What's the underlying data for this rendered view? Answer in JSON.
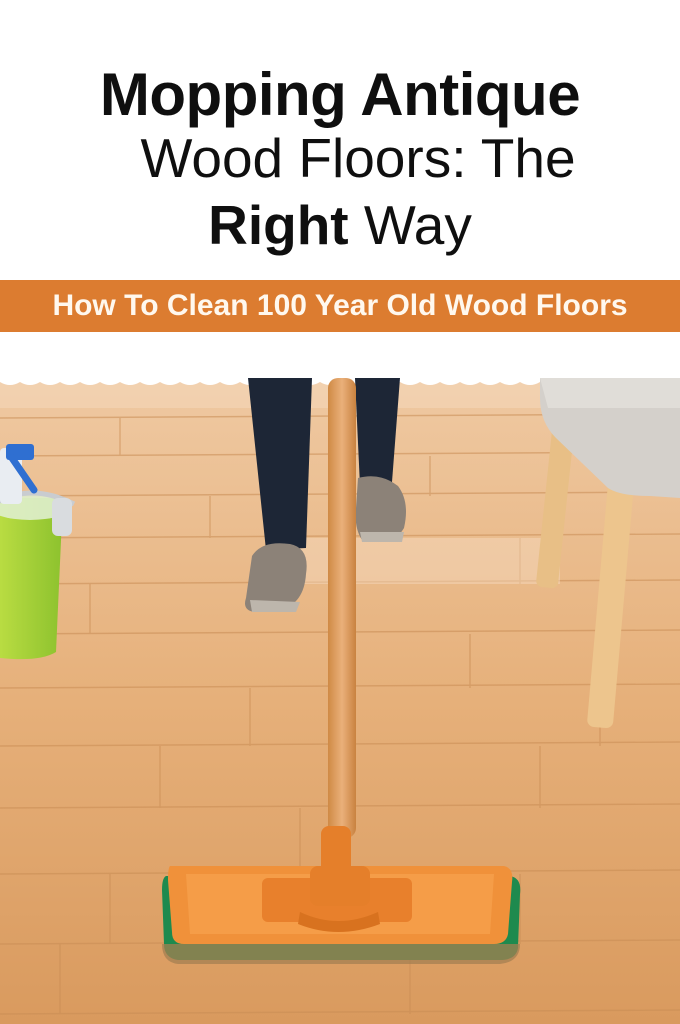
{
  "title": {
    "line1": "Mopping Antique",
    "line2": "Wood Floors: The",
    "line3_bold": "Right",
    "line3_rest": " Way"
  },
  "banner": {
    "text": "How To Clean 100 Year Old Wood Floors",
    "color": "#dc7c30"
  },
  "photo": {
    "icons": [
      "mop-icon",
      "bucket-icon",
      "spray-bottle-icon",
      "chair-icon",
      "person-legs-icon"
    ]
  }
}
